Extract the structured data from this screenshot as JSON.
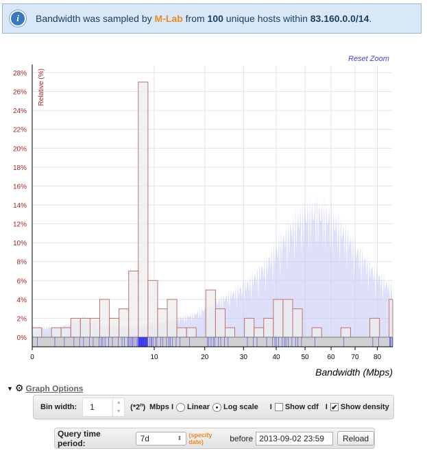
{
  "banner": {
    "icon": "info-icon",
    "t1": "Bandwidth was sampled by ",
    "source": "M-Lab",
    "t2": " from ",
    "hosts": "100",
    "t3": " unique hosts within ",
    "network": "83.160.0.0/14",
    "t4": "."
  },
  "reset_zoom": "Reset Zoom",
  "chart_data": {
    "type": "bar",
    "title": "",
    "xlabel": "Bandwidth (Mbps)",
    "ylabel": "Relative (%)",
    "x_scale": "sqrt",
    "xlim": [
      0,
      87.3
    ],
    "ylim": [
      0,
      28
    ],
    "x_ticks": [
      0,
      10,
      20,
      30,
      40,
      50,
      60,
      70,
      80
    ],
    "y_ticks": [
      "0%",
      "2%",
      "4%",
      "6%",
      "8%",
      "10%",
      "12%",
      "14%",
      "16%",
      "18%",
      "20%",
      "22%",
      "24%",
      "26%",
      "28%"
    ],
    "grid": true,
    "bin_start_mbps": [
      0,
      0.25,
      0.56,
      1,
      1.56,
      2.25,
      3.06,
      4,
      5.06,
      6.25,
      7.56,
      9,
      10.56,
      12.25,
      14.06,
      16,
      20.25,
      22.56,
      25,
      30.25,
      33.06,
      36,
      39.06,
      42.25,
      45.56,
      52.56,
      64,
      76.56,
      85.56
    ],
    "bin_end_mbps": [
      0.06,
      0.56,
      1,
      1.56,
      2.25,
      3.06,
      4,
      5.06,
      6.25,
      7.56,
      9,
      10.56,
      12.25,
      14.06,
      16,
      18.06,
      22.56,
      25,
      27.56,
      33.06,
      36,
      39.06,
      42.25,
      45.56,
      49,
      56.25,
      68.06,
      81,
      87.3
    ],
    "values": [
      1,
      1,
      1,
      2,
      2,
      2,
      4,
      2,
      3,
      7,
      27,
      6,
      3,
      4,
      1,
      1,
      5,
      3,
      1,
      2,
      1,
      2,
      4,
      4,
      3,
      1,
      1,
      2,
      4
    ],
    "show_density": true
  },
  "graph_options": {
    "label": "Graph Options",
    "bin_label": "Bin width:",
    "bin_value": "1",
    "pow": "(*2",
    "pow_sup": "n",
    "pow_end": ")",
    "unit": "Mbps I",
    "linear": "Linear",
    "log": "Log scale",
    "sep1": "I",
    "cdf": "Show cdf",
    "sep2": "I",
    "density": "Show density",
    "scale_selected": "log",
    "show_cdf": false,
    "show_density": true
  },
  "query": {
    "label": "Query time period:",
    "period": "7d",
    "specify": "(specify date)",
    "before": "before",
    "date": "2013-09-02 23:59",
    "reload": "Reload"
  },
  "colors": {
    "bar_fill": "#eeeeee",
    "bar_stroke": "#c07070",
    "density": "#c8cbf5",
    "rug": "#3333ee",
    "axis_label": "#aa2222"
  }
}
